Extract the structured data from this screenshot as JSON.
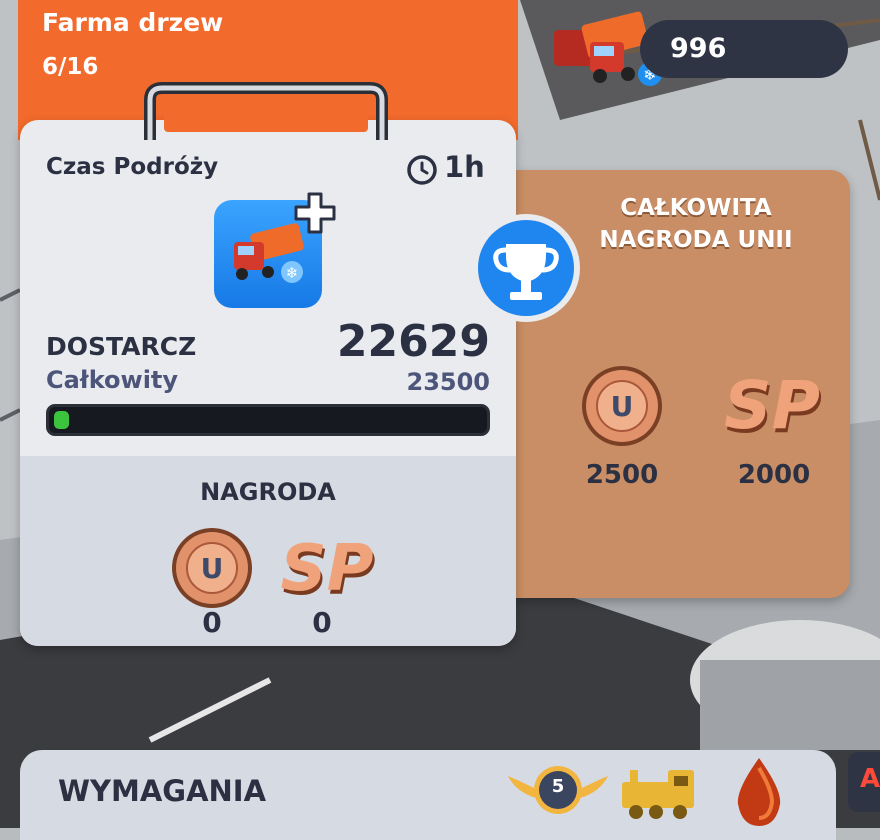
{
  "header": {
    "title": "Farma drzew",
    "count": "6/16"
  },
  "truck_counter": {
    "value": "996",
    "icon": "snow-truck-icon"
  },
  "card": {
    "travel_label": "Czas Podróży",
    "travel_value": "1h",
    "truck_icon": "snow-truck-icon",
    "deliver_label": "DOSTARCZ",
    "deliver_value": "22629",
    "total_label": "Całkowity",
    "total_value": "23500",
    "progress_fraction": 0.036,
    "reward_label": "NAGRODA",
    "reward_union_coins": "0",
    "reward_sp": "0",
    "sp_badge": "SP",
    "coin_letter": "U"
  },
  "union_panel": {
    "title": "CAŁKOWITA\nNAGRODA UNII",
    "union_coins": "2500",
    "sp": "2000"
  },
  "bottom_bar": {
    "label": "WYMAGANIA",
    "level": "5",
    "edge_letter": "A"
  },
  "colors": {
    "orange": "#f26a2c",
    "panel_brown": "#c98e65",
    "accent_blue": "#1779e6",
    "progress_green": "#3cc43e",
    "dark_text": "#2b3142"
  }
}
